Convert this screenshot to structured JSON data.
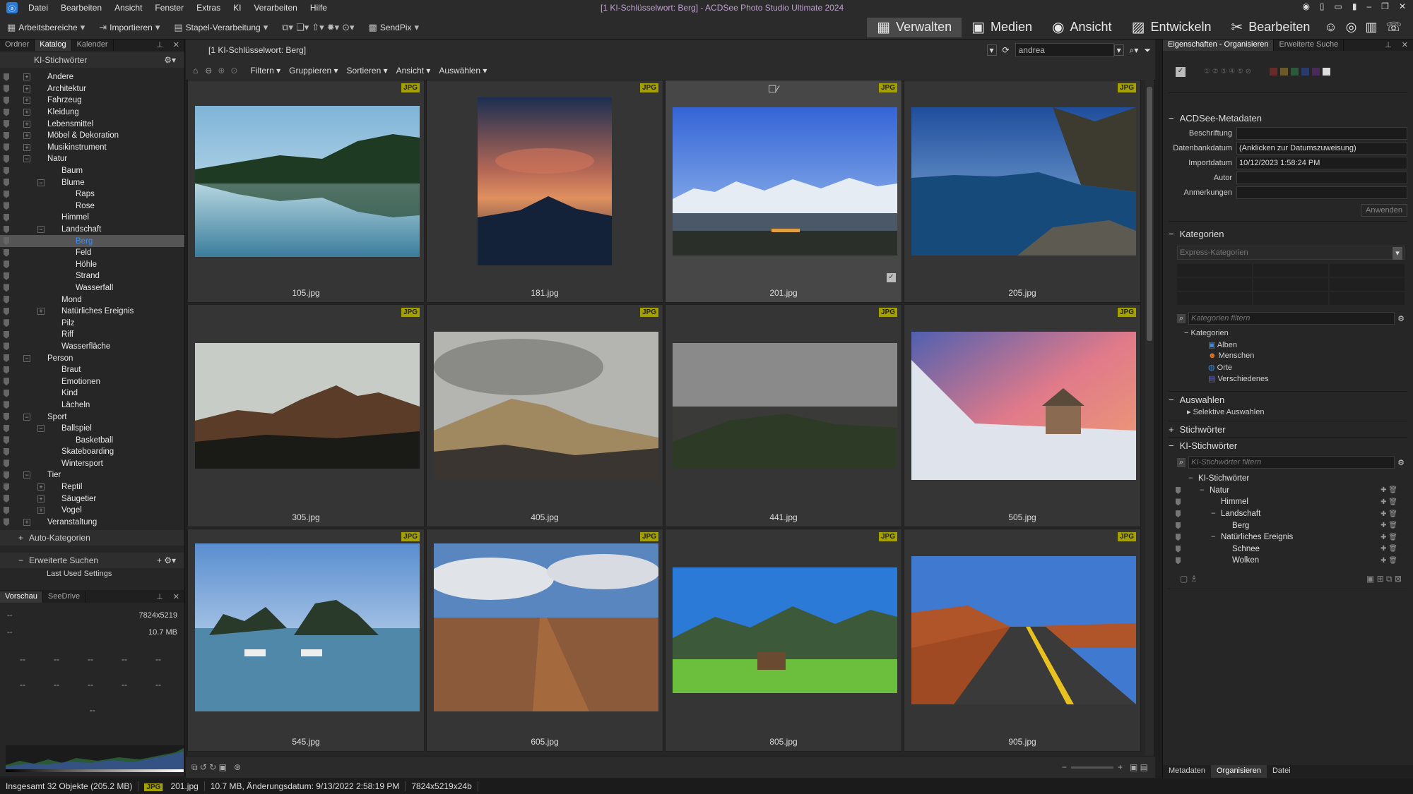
{
  "app": {
    "icon_label": "ⓐ",
    "window_title": "[1 KI-Schlüsselwort: Berg] - ACDSee Photo Studio Ultimate 2024"
  },
  "menu": [
    "Datei",
    "Bearbeiten",
    "Ansicht",
    "Fenster",
    "Extras",
    "KI",
    "Verarbeiten",
    "Hilfe"
  ],
  "toolbar": {
    "workspaces": "Arbeitsbereiche",
    "import": "Importieren",
    "batch": "Stapel-Verarbeitung",
    "sendpix": "SendPix"
  },
  "modes": {
    "manage": "Verwalten",
    "media": "Medien",
    "view": "Ansicht",
    "develop": "Entwickeln",
    "edit": "Bearbeiten"
  },
  "left": {
    "tabs": [
      "Ordner",
      "Katalog",
      "Kalender"
    ],
    "section": "KI-Stichwörter",
    "auto": "Auto-Kategorien",
    "search": "Erweiterte Suchen",
    "last": "Last Used Settings",
    "tree": [
      {
        "label": "Andere",
        "level": 1,
        "exp": "+"
      },
      {
        "label": "Architektur",
        "level": 1,
        "exp": "+"
      },
      {
        "label": "Fahrzeug",
        "level": 1,
        "exp": "+"
      },
      {
        "label": "Kleidung",
        "level": 1,
        "exp": "+"
      },
      {
        "label": "Lebensmittel",
        "level": 1,
        "exp": "+"
      },
      {
        "label": "Möbel & Dekoration",
        "level": 1,
        "exp": "+"
      },
      {
        "label": "Musikinstrument",
        "level": 1,
        "exp": "+"
      },
      {
        "label": "Natur",
        "level": 1,
        "exp": "−"
      },
      {
        "label": "Baum",
        "level": 2,
        "exp": ""
      },
      {
        "label": "Blume",
        "level": 2,
        "exp": "−"
      },
      {
        "label": "Raps",
        "level": 3,
        "exp": ""
      },
      {
        "label": "Rose",
        "level": 3,
        "exp": ""
      },
      {
        "label": "Himmel",
        "level": 2,
        "exp": ""
      },
      {
        "label": "Landschaft",
        "level": 2,
        "exp": "−"
      },
      {
        "label": "Berg",
        "level": 3,
        "exp": "",
        "sel": true
      },
      {
        "label": "Feld",
        "level": 3,
        "exp": ""
      },
      {
        "label": "Höhle",
        "level": 3,
        "exp": ""
      },
      {
        "label": "Strand",
        "level": 3,
        "exp": ""
      },
      {
        "label": "Wasserfall",
        "level": 3,
        "exp": ""
      },
      {
        "label": "Mond",
        "level": 2,
        "exp": ""
      },
      {
        "label": "Natürliches Ereignis",
        "level": 2,
        "exp": "+"
      },
      {
        "label": "Pilz",
        "level": 2,
        "exp": ""
      },
      {
        "label": "Riff",
        "level": 2,
        "exp": ""
      },
      {
        "label": "Wasserfläche",
        "level": 2,
        "exp": ""
      },
      {
        "label": "Person",
        "level": 1,
        "exp": "−"
      },
      {
        "label": "Braut",
        "level": 2,
        "exp": ""
      },
      {
        "label": "Emotionen",
        "level": 2,
        "exp": ""
      },
      {
        "label": "Kind",
        "level": 2,
        "exp": ""
      },
      {
        "label": "Lächeln",
        "level": 2,
        "exp": ""
      },
      {
        "label": "Sport",
        "level": 1,
        "exp": "−"
      },
      {
        "label": "Ballspiel",
        "level": 2,
        "exp": "−"
      },
      {
        "label": "Basketball",
        "level": 3,
        "exp": ""
      },
      {
        "label": "Skateboarding",
        "level": 2,
        "exp": ""
      },
      {
        "label": "Wintersport",
        "level": 2,
        "exp": ""
      },
      {
        "label": "Tier",
        "level": 1,
        "exp": "−"
      },
      {
        "label": "Reptil",
        "level": 2,
        "exp": "+"
      },
      {
        "label": "Säugetier",
        "level": 2,
        "exp": "+"
      },
      {
        "label": "Vogel",
        "level": 2,
        "exp": "+"
      },
      {
        "label": "Veranstaltung",
        "level": 1,
        "exp": "+"
      }
    ]
  },
  "preview": {
    "tabs": [
      "Vorschau",
      "SeeDrive"
    ],
    "dims": "7824x5219",
    "size": "10.7 MB",
    "empty": "--"
  },
  "path": {
    "label": "[1 KI-Schlüsselwort: Berg]",
    "search": "andrea"
  },
  "nav": {
    "filter": "Filtern",
    "group": "Gruppieren",
    "sort": "Sortieren",
    "view": "Ansicht",
    "select": "Auswählen"
  },
  "thumbs": [
    {
      "name": "105.jpg",
      "badge": "JPG"
    },
    {
      "name": "181.jpg",
      "badge": "JPG"
    },
    {
      "name": "201.jpg",
      "badge": "JPG",
      "sel": true
    },
    {
      "name": "205.jpg",
      "badge": "JPG"
    },
    {
      "name": "305.jpg",
      "badge": "JPG"
    },
    {
      "name": "405.jpg",
      "badge": "JPG"
    },
    {
      "name": "441.jpg",
      "badge": "JPG"
    },
    {
      "name": "505.jpg",
      "badge": "JPG"
    },
    {
      "name": "545.jpg",
      "badge": "JPG"
    },
    {
      "name": "605.jpg",
      "badge": "JPG"
    },
    {
      "name": "805.jpg",
      "badge": "JPG"
    },
    {
      "name": "905.jpg",
      "badge": "JPG"
    }
  ],
  "right": {
    "tabs": [
      "Eigenschaften - Organisieren",
      "Erweiterte Suche"
    ],
    "meta_title": "ACDSee-Metadaten",
    "fields": [
      {
        "label": "Beschriftung",
        "value": ""
      },
      {
        "label": "Datenbankdatum",
        "value": "(Anklicken zur Datumszuweisung)"
      },
      {
        "label": "Importdatum",
        "value": "10/12/2023 1:58:24 PM"
      },
      {
        "label": "Autor",
        "value": ""
      },
      {
        "label": "Anmerkungen",
        "value": ""
      }
    ],
    "apply": "Anwenden",
    "cat_title": "Kategorien",
    "express": "Express-Kategorien",
    "cat_filter": "Kategorien filtern",
    "cats": [
      "Kategorien",
      "Alben",
      "Menschen",
      "Orte",
      "Verschiedenes"
    ],
    "select_title": "Auswahlen",
    "selective": "Selektive Auswahlen",
    "kw_title": "Stichwörter",
    "aikw_title": "KI-Stichwörter",
    "aikw_filter": "KI-Stichwörter filtern",
    "aikw": [
      {
        "label": "KI-Stichwörter",
        "level": 0
      },
      {
        "label": "Natur",
        "level": 1
      },
      {
        "label": "Himmel",
        "level": 2
      },
      {
        "label": "Landschaft",
        "level": 2
      },
      {
        "label": "Berg",
        "level": 3
      },
      {
        "label": "Natürliches Ereignis",
        "level": 2
      },
      {
        "label": "Schnee",
        "level": 3
      },
      {
        "label": "Wolken",
        "level": 3
      }
    ],
    "bottom_tabs": [
      "Metadaten",
      "Organisieren",
      "Datei"
    ]
  },
  "status": {
    "total": "Insgesamt 32 Objekte  (205.2 MB)",
    "type": "JPG",
    "file": "201.jpg",
    "info": "10.7 MB, Änderungsdatum: 9/13/2022 2:58:19 PM",
    "dims": "7824x5219x24b"
  }
}
